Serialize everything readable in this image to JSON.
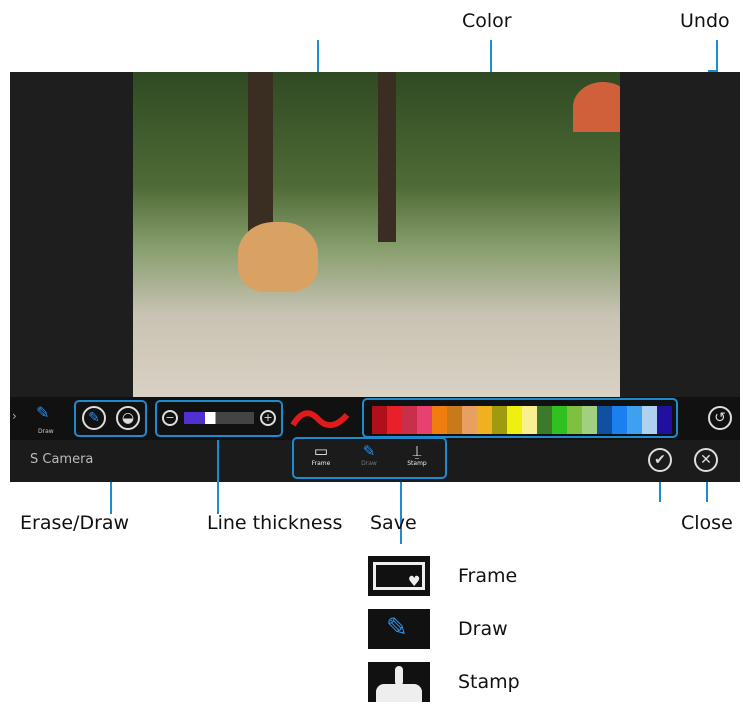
{
  "callouts": {
    "color": "Color",
    "undo": "Undo",
    "erase_draw": "Erase/Draw",
    "line_thickness": "Line thickness",
    "save": "Save",
    "close": "Close"
  },
  "app": {
    "name": "S Camera",
    "side_tool": "Draw",
    "modes": [
      {
        "label": "Frame"
      },
      {
        "label": "Draw"
      },
      {
        "label": "Stamp"
      }
    ]
  },
  "palette": [
    "#b0101a",
    "#e8202a",
    "#c8304a",
    "#e84070",
    "#f07d10",
    "#c87a1a",
    "#e8a060",
    "#f0b020",
    "#a09a10",
    "#f0f010",
    "#f8f090",
    "#3a7a2a",
    "#30c020",
    "#80c040",
    "#a0d080",
    "#1050a0",
    "#1a80f0",
    "#40a0f0",
    "#b0d0f0",
    "#2010a0"
  ],
  "legend": [
    {
      "label": "Frame"
    },
    {
      "label": "Draw"
    },
    {
      "label": "Stamp"
    }
  ],
  "accent": "#1e8ad0"
}
